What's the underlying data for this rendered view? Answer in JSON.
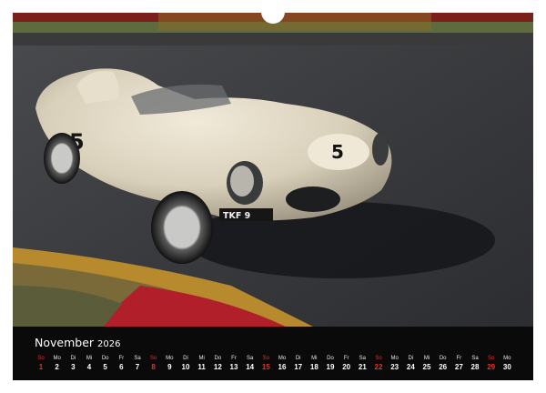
{
  "calendar": {
    "month": "November",
    "year": "2026",
    "days": [
      {
        "dow": "So",
        "num": "1",
        "sunday": true
      },
      {
        "dow": "Mo",
        "num": "2"
      },
      {
        "dow": "Di",
        "num": "3"
      },
      {
        "dow": "Mi",
        "num": "4"
      },
      {
        "dow": "Do",
        "num": "5"
      },
      {
        "dow": "Fr",
        "num": "6"
      },
      {
        "dow": "Sa",
        "num": "7"
      },
      {
        "dow": "So",
        "num": "8",
        "sunday": true
      },
      {
        "dow": "Mo",
        "num": "9"
      },
      {
        "dow": "Di",
        "num": "10"
      },
      {
        "dow": "Mi",
        "num": "11"
      },
      {
        "dow": "Do",
        "num": "12"
      },
      {
        "dow": "Fr",
        "num": "13"
      },
      {
        "dow": "Sa",
        "num": "14"
      },
      {
        "dow": "So",
        "num": "15",
        "sunday": true
      },
      {
        "dow": "Mo",
        "num": "16"
      },
      {
        "dow": "Di",
        "num": "17"
      },
      {
        "dow": "Mi",
        "num": "18"
      },
      {
        "dow": "Do",
        "num": "19"
      },
      {
        "dow": "Fr",
        "num": "20"
      },
      {
        "dow": "Sa",
        "num": "21"
      },
      {
        "dow": "So",
        "num": "22",
        "sunday": true
      },
      {
        "dow": "Mo",
        "num": "23"
      },
      {
        "dow": "Di",
        "num": "24"
      },
      {
        "dow": "Mi",
        "num": "25"
      },
      {
        "dow": "Do",
        "num": "26"
      },
      {
        "dow": "Fr",
        "num": "27"
      },
      {
        "dow": "Sa",
        "num": "28"
      },
      {
        "dow": "So",
        "num": "29",
        "sunday": true
      },
      {
        "dow": "Mo",
        "num": "30"
      }
    ]
  },
  "photo": {
    "car_number": "5",
    "plate": "TKF 9"
  },
  "colors": {
    "sunday": "#e0322e",
    "strip": "#0a0a0a"
  }
}
